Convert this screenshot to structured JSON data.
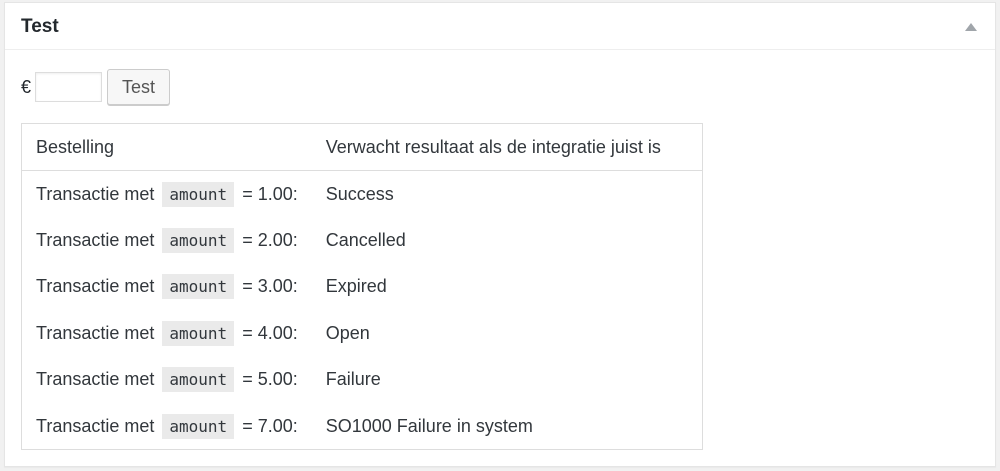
{
  "box": {
    "title": "Test",
    "toggle_icon": "arrow-up-icon"
  },
  "form": {
    "currency_symbol": "€",
    "amount_value": "",
    "button_label": "Test"
  },
  "table": {
    "headers": [
      "Bestelling",
      "Verwacht resultaat als de integratie juist is"
    ],
    "rows": [
      {
        "prefix": "Transactie met",
        "code": "amount",
        "suffix": "= 1.00:",
        "result": "Success"
      },
      {
        "prefix": "Transactie met",
        "code": "amount",
        "suffix": "= 2.00:",
        "result": "Cancelled"
      },
      {
        "prefix": "Transactie met",
        "code": "amount",
        "suffix": "= 3.00:",
        "result": "Expired"
      },
      {
        "prefix": "Transactie met",
        "code": "amount",
        "suffix": "= 4.00:",
        "result": "Open"
      },
      {
        "prefix": "Transactie met",
        "code": "amount",
        "suffix": "= 5.00:",
        "result": "Failure"
      },
      {
        "prefix": "Transactie met",
        "code": "amount",
        "suffix": "= 7.00:",
        "result": "SO1000 Failure in system"
      }
    ]
  }
}
